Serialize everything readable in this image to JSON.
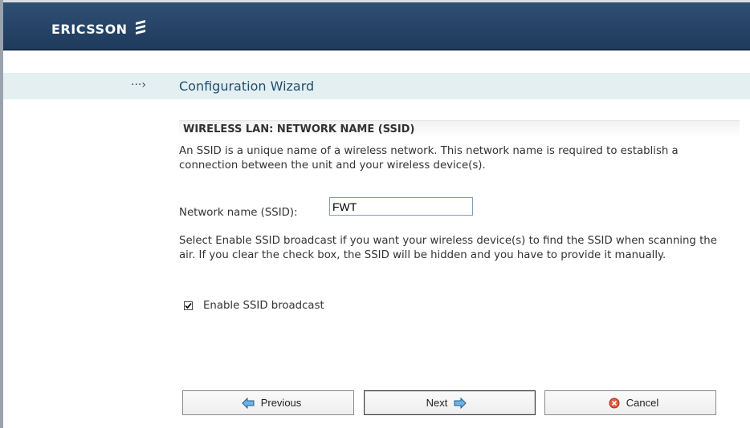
{
  "header": {
    "brand": "ERICSSON",
    "logo_icon": "ericsson-logo-icon",
    "bg_color": "#1e3a5c"
  },
  "wizard": {
    "arrow": "···›",
    "title": "Configuration Wizard"
  },
  "section": {
    "title": "WIRELESS LAN: NETWORK NAME (SSID)",
    "intro": "An SSID is a unique name of a wireless network. This network name is required to establish a connection between the unit and your wireless device(s).",
    "ssid_label": "Network name (SSID):",
    "ssid_value": "FWT",
    "broadcast_help": "Select Enable SSID broadcast if you want your wireless device(s) to find the SSID when scanning the air. If you clear the check box, the SSID will be hidden and you have to provide it manually.",
    "broadcast_label": "Enable SSID broadcast",
    "broadcast_checked": true
  },
  "buttons": {
    "previous": "Previous",
    "next": "Next",
    "cancel": "Cancel"
  }
}
